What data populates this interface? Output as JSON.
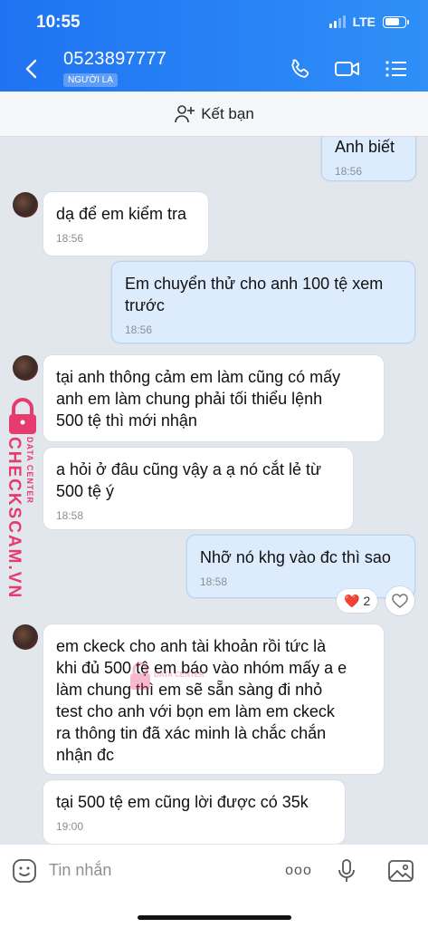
{
  "status": {
    "time": "10:55",
    "network": "LTE"
  },
  "header": {
    "contact": "0523897777",
    "badge": "NGƯỜI LẠ"
  },
  "friend_bar": {
    "label": "Kết bạn"
  },
  "messages": [
    {
      "dir": "out",
      "lines": [
        "Anh biết"
      ],
      "time": "18:56"
    },
    {
      "dir": "in",
      "lines": [
        "dạ để em kiểm tra"
      ],
      "time": "18:56"
    },
    {
      "dir": "out",
      "lines": [
        "Em chuyển thử cho anh 100 tệ xem",
        "trước"
      ],
      "time": "18:56"
    },
    {
      "dir": "in",
      "lines": [
        "tại anh thông cảm em làm  cũng có  mấy",
        "anh em làm chung phải tối thiểu lệnh",
        "500 tệ  thì mới nhận"
      ],
      "time": ""
    },
    {
      "dir": "in",
      "lines": [
        "a hỏi ở đâu cũng vậy a ạ nó cắt lẻ từ",
        "500 tệ ý"
      ],
      "time": "18:58"
    },
    {
      "dir": "out",
      "lines": [
        "Nhỡ nó khg vào đc thì sao"
      ],
      "time": "18:58"
    },
    {
      "dir": "in",
      "lines": [
        "em ckeck cho anh tài khoản rồi tức là",
        "khi đủ 500 tệ em báo vào nhóm mấy a e",
        "làm chung  thì em sẽ sẵn sàng đi nhỏ",
        "test cho anh với bọn em làm em ckeck",
        "ra thông tin đã xác minh là chắc chắn",
        "nhận đc"
      ],
      "time": ""
    },
    {
      "dir": "in",
      "lines": [
        "tại 500 tệ em cũng lời được có 35k"
      ],
      "time": "19:00"
    }
  ],
  "reaction": {
    "emoji": "❤️",
    "count": "2"
  },
  "watermark": {
    "brand": "CHECKSCAM.VN",
    "sub": "DATA CENTER"
  },
  "input": {
    "placeholder": "Tin nhắn",
    "more": "ooo"
  },
  "colors": {
    "header": "#1f73f2",
    "outgoing": "#dcecfd",
    "incoming": "#ffffff",
    "chat_bg": "#e2e7ee",
    "watermark": "#e63b6f"
  }
}
